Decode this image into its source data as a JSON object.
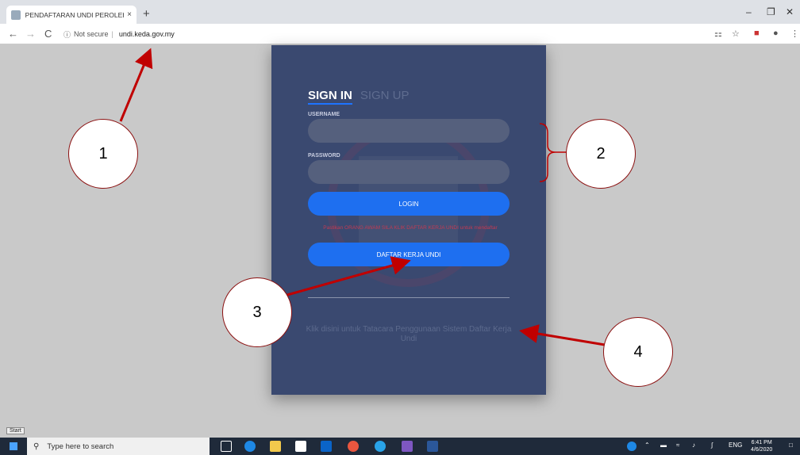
{
  "browser": {
    "tab_title": "PENDAFTARAN UNDI PEROLEHA",
    "tab_close": "×",
    "new_tab": "+",
    "security": "Not secure",
    "url": "undi.keda.gov.my",
    "back": "←",
    "forward": "→",
    "reload": "C"
  },
  "panel": {
    "tab_signin": "SIGN IN",
    "tab_signup": "SIGN UP",
    "username_label": "USERNAME",
    "password_label": "PASSWORD",
    "login_button": "LOGIN",
    "warning_text": "Pastikan ORANG AWAM SILA KLIK DAFTAR KERJA UNDI untuk mendaftar",
    "register_button": "DAFTAR KERJA UNDI",
    "help_link": "Klik disini untuk Tatacara Penggunaan Sistem Daftar Kerja Undi"
  },
  "annotations": {
    "c1": "1",
    "c2": "2",
    "c3": "3",
    "c4": "4",
    "arrow_color": "#c00000"
  },
  "taskbar": {
    "start_tooltip": "Start",
    "search_placeholder": "Type here to search",
    "lang": "ENG",
    "time": "6:41 PM",
    "date": "4/6/2020"
  }
}
